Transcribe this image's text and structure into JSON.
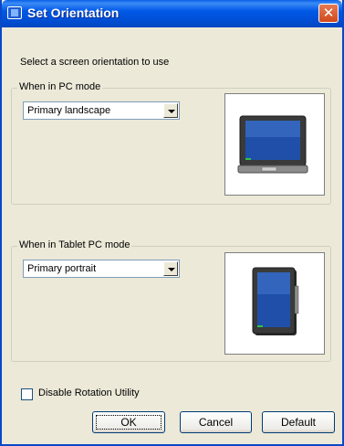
{
  "window": {
    "title": "Set Orientation",
    "close_glyph": "✕"
  },
  "instruction": "Select a screen orientation to use",
  "pc_mode": {
    "legend": "When in PC mode",
    "selected": "Primary landscape",
    "preview_icon": "landscape-tablet-pc-icon"
  },
  "tablet_mode": {
    "legend": "When in Tablet PC mode",
    "selected": "Primary portrait",
    "preview_icon": "portrait-tablet-pc-icon"
  },
  "options": {
    "disable_rotation_label": "Disable Rotation Utility",
    "disable_rotation_checked": false
  },
  "buttons": {
    "ok": "OK",
    "cancel": "Cancel",
    "default": "Default"
  },
  "colors": {
    "titlebar": "#0058e6",
    "dialog_bg": "#ece9d8",
    "screen_blue": "#1f4fa8"
  }
}
